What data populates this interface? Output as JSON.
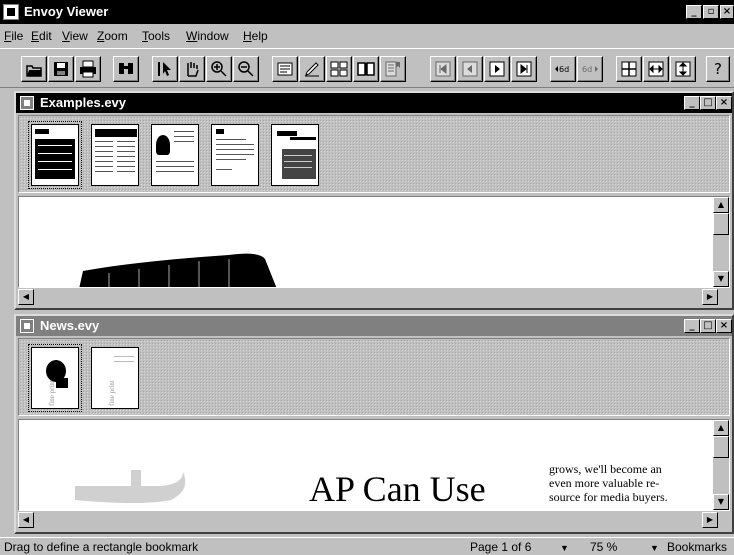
{
  "app": {
    "title": "Envoy Viewer"
  },
  "menu": [
    "File",
    "Edit",
    "View",
    "Zoom",
    "Tools",
    "Window",
    "Help"
  ],
  "toolbar": {
    "buttons": [
      "open-icon",
      "save-icon",
      "print-icon",
      "find-icon",
      "select-arrow-icon",
      "hand-icon",
      "zoom-in-icon",
      "zoom-out-icon",
      "note-icon",
      "highlight-icon",
      "thumbnails-icon",
      "book-icon",
      "bookmark-icon",
      "first-page-icon",
      "prev-page-icon",
      "next-page-icon",
      "last-page-icon",
      "back-icon",
      "forward-icon",
      "fit-page-icon",
      "fit-width-icon",
      "fit-height-icon",
      "help-icon"
    ],
    "help_glyph": "?"
  },
  "windows": [
    {
      "title": "Examples.evy",
      "active": true,
      "thumbnails": 5,
      "selected_thumbnail": 1
    },
    {
      "title": "News.evy",
      "active": false,
      "thumbnails": 2,
      "selected_thumbnail": 1,
      "thumb_caption": "fine print",
      "page": {
        "headline": "AP Can Use",
        "body_lines": [
          "grows, we'll become an",
          "even more valuable re-",
          "source for media buyers."
        ]
      }
    }
  ],
  "statusbar": {
    "message": "Drag to define a rectangle bookmark",
    "page": "Page 1 of 6",
    "zoom": "75 %",
    "bookmarks": "Bookmarks"
  }
}
